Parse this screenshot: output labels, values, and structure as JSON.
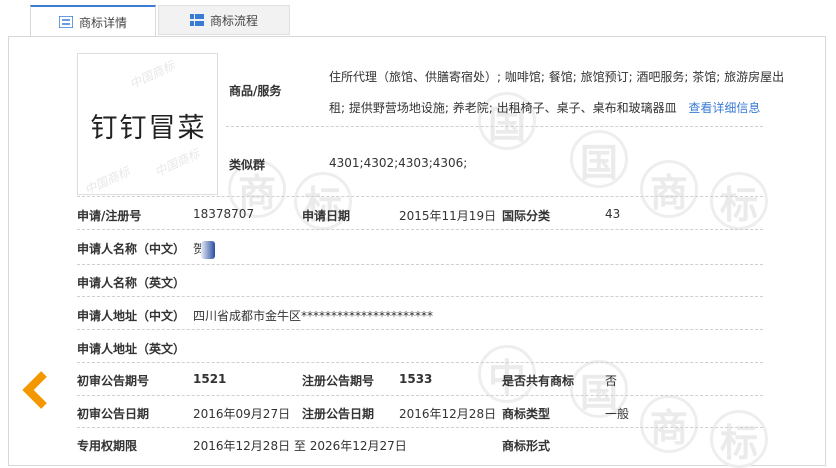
{
  "tabs": [
    {
      "label": "商标详情",
      "icon": "list-icon"
    },
    {
      "label": "商标流程",
      "icon": "grid-icon"
    }
  ],
  "watermark": {
    "char1": "商",
    "char2": "标",
    "char3": "中",
    "char4": "国"
  },
  "logo": {
    "text": "钉钉冒菜",
    "watermark": "中国商标"
  },
  "goods": {
    "label": "商品/服务",
    "line1": "住所代理（旅馆、供膳寄宿处）; 咖啡馆; 餐馆; 旅馆预订; 酒吧服务; 茶馆; 旅游房屋出",
    "line2": "租; 提供野营场地设施; 养老院; 出租椅子、桌子、桌布和玻璃器皿",
    "link": "查看详细信息"
  },
  "similar": {
    "label": "类似群",
    "value": "4301;4302;4303;4306;"
  },
  "rows": {
    "reg_no_label": "申请/注册号",
    "reg_no": "18378707",
    "apply_date_label": "申请日期",
    "apply_date": "2015年11月19日",
    "intl_class_label": "国际分类",
    "intl_class": "43",
    "applicant_cn_label": "申请人名称（中文）",
    "applicant_cn": "贺",
    "applicant_en_label": "申请人名称（英文）",
    "address_cn_label": "申请人地址（中文）",
    "address_cn": "四川省成都市金牛区**********************",
    "address_en_label": "申请人地址（英文）",
    "prelim_no_label": "初审公告期号",
    "prelim_no": "1521",
    "reg_pub_no_label": "注册公告期号",
    "reg_pub_no": "1533",
    "shared_label": "是否共有商标",
    "shared": "否",
    "prelim_date_label": "初审公告日期",
    "prelim_date": "2016年09月27日",
    "reg_pub_date_label": "注册公告日期",
    "reg_pub_date": "2016年12月28日",
    "type_label": "商标类型",
    "type": "一般",
    "valid_label": "专用权期限",
    "valid": "2016年12月28日 至 2026年12月27日",
    "form_label": "商标形式"
  },
  "colors": {
    "accent": "#3a7bd5",
    "arrow": "#f39800"
  }
}
